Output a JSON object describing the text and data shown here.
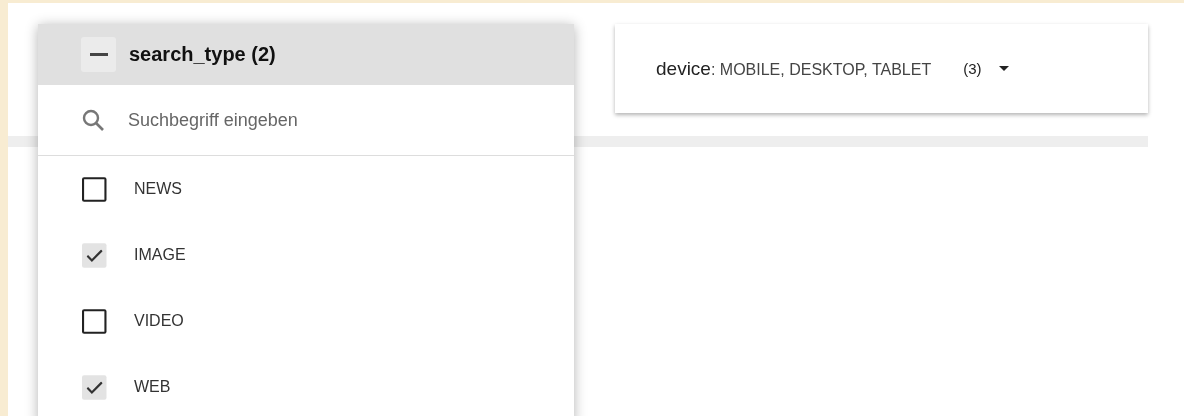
{
  "open_filter": {
    "name": "search_type",
    "count": "(2)",
    "expanded": true,
    "search": {
      "placeholder": "Suchbegriff eingeben"
    },
    "options": [
      {
        "label": "NEWS",
        "checked": false
      },
      {
        "label": "IMAGE",
        "checked": true
      },
      {
        "label": "VIDEO",
        "checked": false
      },
      {
        "label": "WEB",
        "checked": true
      }
    ]
  },
  "filter_chip": {
    "name": "device",
    "values": ": MOBILE, DESKTOP, TABLET",
    "count": "(3)"
  }
}
